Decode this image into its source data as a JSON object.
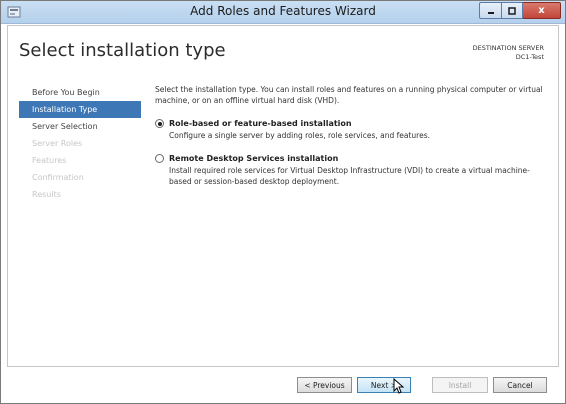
{
  "window": {
    "title": "Add Roles and Features Wizard",
    "close_glyph": "x",
    "icons": [
      "app-icon",
      "minimize-icon",
      "maximize-icon",
      "close-icon"
    ]
  },
  "header": {
    "page_title": "Select installation type",
    "destination_label": "DESTINATION SERVER",
    "destination_server": "DC1-Test"
  },
  "sidebar": {
    "items": [
      {
        "label": "Before You Begin",
        "state": "normal"
      },
      {
        "label": "Installation Type",
        "state": "active"
      },
      {
        "label": "Server Selection",
        "state": "normal"
      },
      {
        "label": "Server Roles",
        "state": "disabled"
      },
      {
        "label": "Features",
        "state": "disabled"
      },
      {
        "label": "Confirmation",
        "state": "disabled"
      },
      {
        "label": "Results",
        "state": "disabled"
      }
    ]
  },
  "main": {
    "intro": "Select the installation type. You can install roles and features on a running physical computer or virtual machine, or on an offline virtual hard disk (VHD).",
    "options": [
      {
        "title": "Role-based or feature-based installation",
        "description": "Configure a single server by adding roles, role services, and features.",
        "selected": true
      },
      {
        "title": "Remote Desktop Services installation",
        "description": "Install required role services for Virtual Desktop Infrastructure (VDI) to create a virtual machine-based or session-based desktop deployment.",
        "selected": false
      }
    ]
  },
  "footer": {
    "previous_label": "< Previous",
    "next_label": "Next >",
    "install_label": "Install",
    "cancel_label": "Cancel"
  },
  "colors": {
    "active_nav": "#3d77b6",
    "titlebar": "#b4d0ec",
    "close_button": "#c3463a"
  }
}
